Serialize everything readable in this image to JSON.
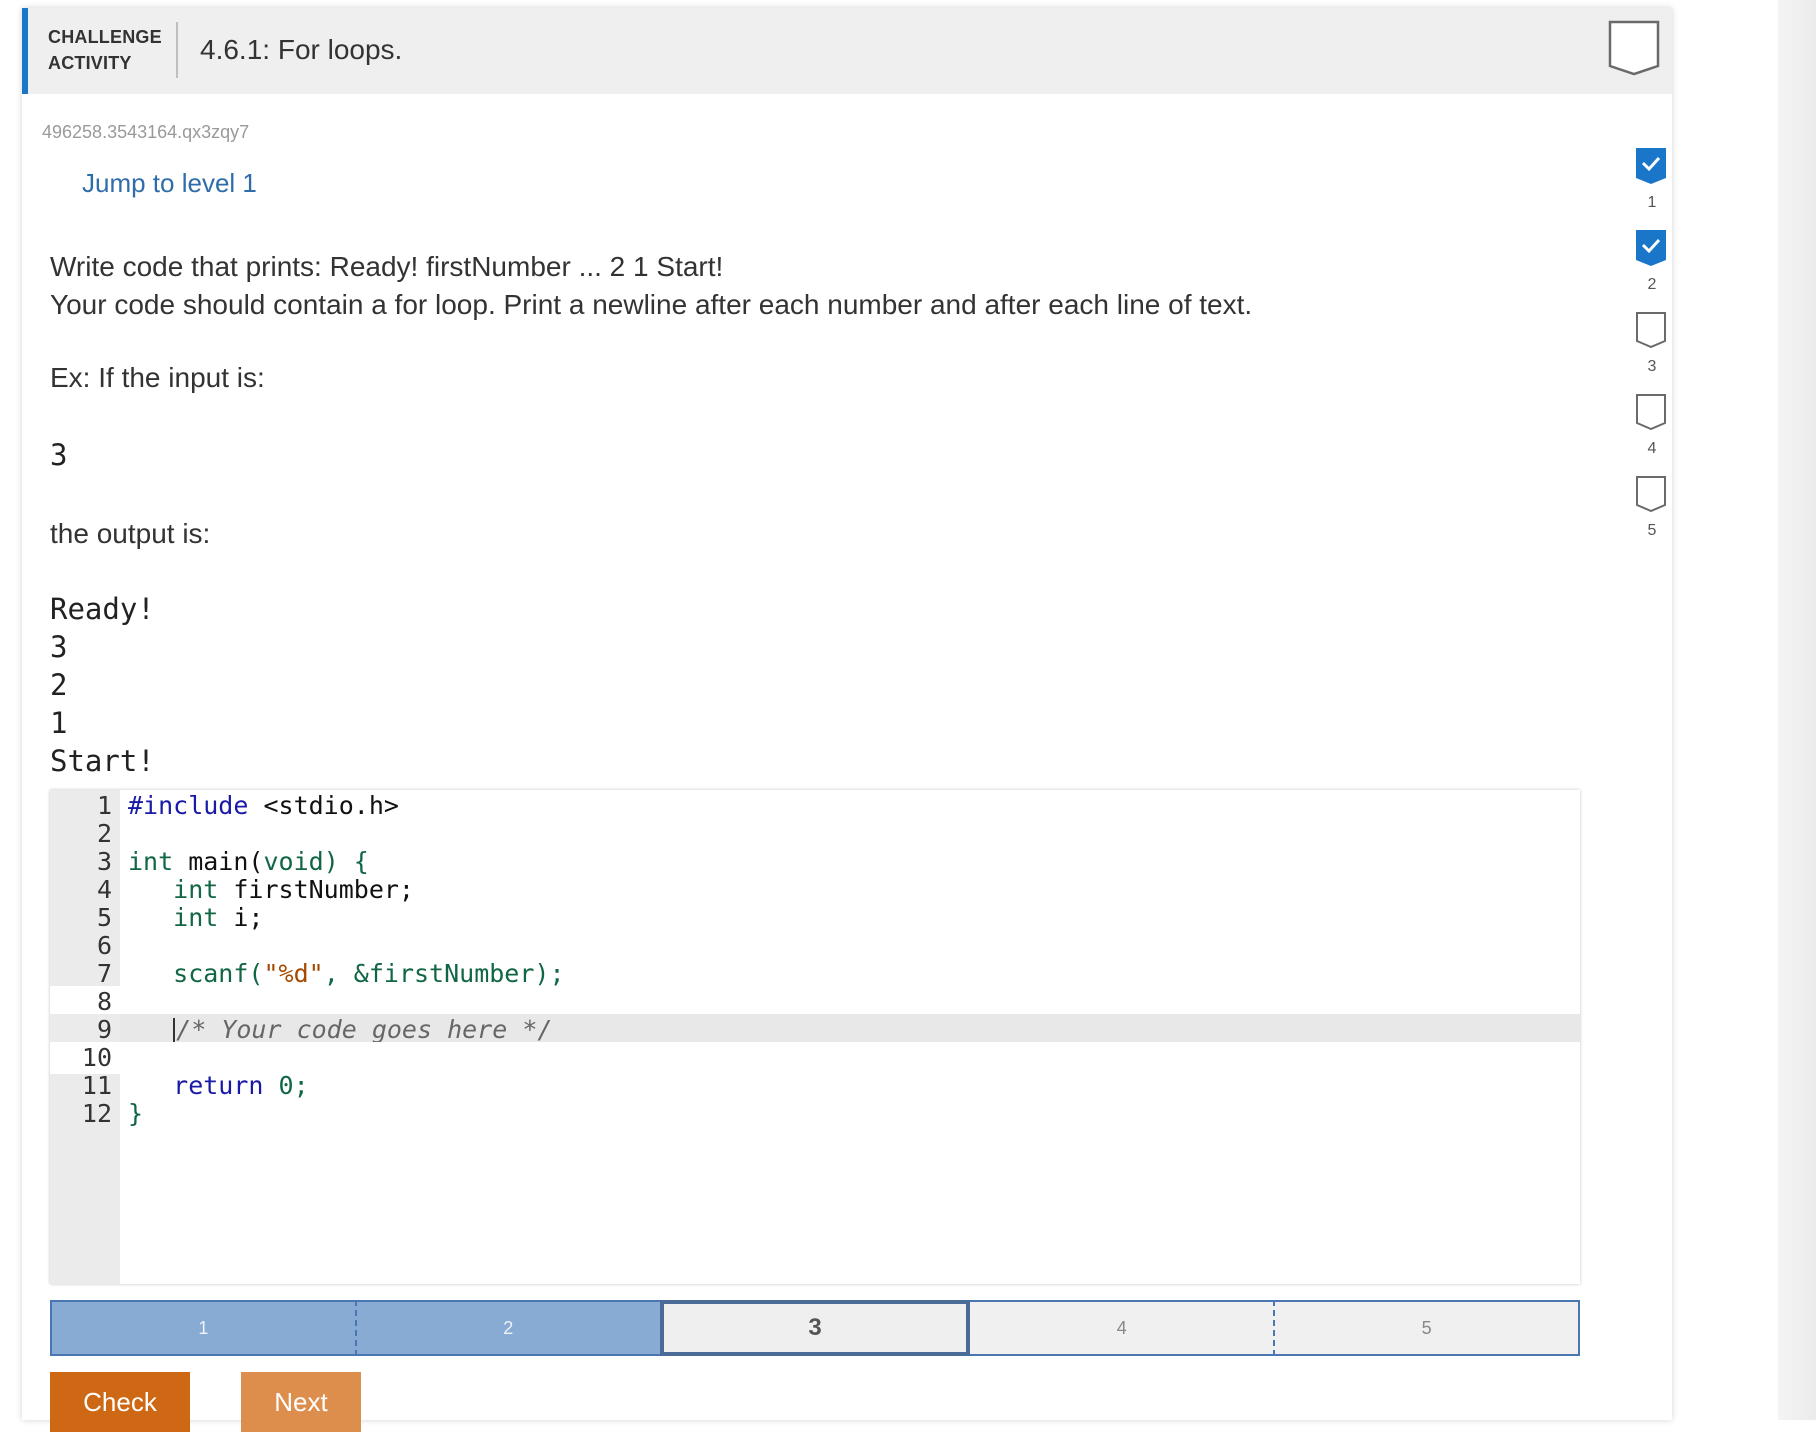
{
  "header": {
    "kicker_line1": "CHALLENGE",
    "kicker_line2": "ACTIVITY",
    "title": "4.6.1: For loops."
  },
  "activity_id": "496258.3543164.qx3zqy7",
  "jump_link": "Jump to level 1",
  "prompt": {
    "line1": "Write code that prints: Ready! firstNumber ... 2 1 Start!",
    "line2": "Your code should contain a for loop. Print a newline after each number and after each line of text."
  },
  "example": {
    "input_label": "Ex: If the input is:",
    "input_value": "3",
    "output_label": "the output is:",
    "output_lines": [
      "Ready!",
      "3",
      "2",
      "1",
      "Start!"
    ]
  },
  "editor": {
    "line_numbers": [
      "1",
      "2",
      "3",
      "4",
      "5",
      "6",
      "7",
      "8",
      "9",
      "10",
      "11",
      "12"
    ],
    "code": {
      "l1_directive": "#include",
      "l1_header": " <stdio.h>",
      "l3_type": "int",
      "l3_rest": " main(",
      "l3_void": "void",
      "l3_end": ") {",
      "l4_type": "int",
      "l4_rest": " firstNumber;",
      "l5_type": "int",
      "l5_rest": " i;",
      "l7_fn": "scanf(",
      "l7_str": "\"%d\"",
      "l7_rest": ", &firstNumber);",
      "l9_comment": "/* Your code goes here */",
      "l11_kw": "return",
      "l11_val": " 0;",
      "l12_brace": "}"
    }
  },
  "levels": [
    {
      "label": "1",
      "state": "done"
    },
    {
      "label": "2",
      "state": "done"
    },
    {
      "label": "3",
      "state": "current"
    },
    {
      "label": "4",
      "state": "todo"
    },
    {
      "label": "5",
      "state": "todo"
    }
  ],
  "buttons": {
    "check": "Check",
    "next": "Next"
  },
  "progress": [
    {
      "label": "1",
      "completed": true
    },
    {
      "label": "2",
      "completed": true
    },
    {
      "label": "3",
      "completed": false
    },
    {
      "label": "4",
      "completed": false
    },
    {
      "label": "5",
      "completed": false
    }
  ],
  "colors": {
    "accent_blue": "#1976c9",
    "check_orange": "#cf6814",
    "next_orange": "#dd8d4c",
    "level_done": "#87abd3",
    "progress_done": "#1976c9"
  }
}
